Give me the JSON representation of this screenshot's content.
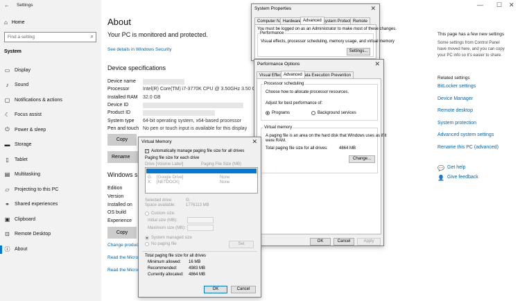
{
  "settings": {
    "window_title": "Settings",
    "home": "Home",
    "search_placeholder": "Find a setting",
    "section": "System",
    "nav": [
      {
        "label": "Display",
        "icon": "display-icon"
      },
      {
        "label": "Sound",
        "icon": "sound-icon"
      },
      {
        "label": "Notifications & actions",
        "icon": "notifications-icon"
      },
      {
        "label": "Focus assist",
        "icon": "focus-assist-icon"
      },
      {
        "label": "Power & sleep",
        "icon": "power-icon"
      },
      {
        "label": "Storage",
        "icon": "storage-icon"
      },
      {
        "label": "Tablet",
        "icon": "tablet-icon"
      },
      {
        "label": "Multitasking",
        "icon": "multitasking-icon"
      },
      {
        "label": "Projecting to this PC",
        "icon": "projecting-icon"
      },
      {
        "label": "Shared experiences",
        "icon": "shared-icon"
      },
      {
        "label": "Clipboard",
        "icon": "clipboard-icon"
      },
      {
        "label": "Remote Desktop",
        "icon": "remote-desktop-icon"
      },
      {
        "label": "About",
        "icon": "about-icon"
      }
    ]
  },
  "about": {
    "title": "About",
    "subtitle": "Your PC is monitored and protected.",
    "security_link": "See details in Windows Security",
    "device_specs_heading": "Device specifications",
    "specs": [
      {
        "key": "Device name",
        "value": ""
      },
      {
        "key": "Processor",
        "value": "Intel(R) Core(TM) i7-3770K CPU @ 3.50GHz   3.50 GHz"
      },
      {
        "key": "Installed RAM",
        "value": "32.0 GB"
      },
      {
        "key": "Device ID",
        "value": ""
      },
      {
        "key": "Product ID",
        "value": ""
      },
      {
        "key": "System type",
        "value": "64-bit operating system, x64-based processor"
      },
      {
        "key": "Pen and touch",
        "value": "No pen or touch input is available for this display"
      }
    ],
    "copy_button": "Copy",
    "rename_button": "Rename this P",
    "windows_spec_heading": "Windows sp",
    "win_specs": [
      "Edition",
      "Version",
      "Installed on",
      "OS build",
      "Experience"
    ],
    "copy_button_2": "Copy",
    "link_change_product": "Change product",
    "link_read_1": "Read the Micros",
    "link_read_2": "Read the Micros"
  },
  "right_pane": {
    "heading": "This page has a few new settings",
    "text_lines": [
      "Some settings from Control Panel",
      "have moved here, and you can copy",
      "your PC info so it's easier to share."
    ],
    "related_heading": "Related settings",
    "related": [
      "BitLocker settings",
      "Device Manager",
      "Remote desktop",
      "System protection",
      "Advanced system settings",
      "Rename this PC (advanced)"
    ],
    "help": "Get help",
    "feedback": "Give feedback"
  },
  "system_properties": {
    "title": "System Properties",
    "tabs": [
      "Computer Name",
      "Hardware",
      "Advanced",
      "System Protection",
      "Remote"
    ],
    "admin_note": "You must be logged on as an Administrator to make most of these changes.",
    "performance_label": "Performance",
    "performance_desc": "Visual effects, processor scheduling, memory usage, and virtual memory",
    "settings_button": "Settings..."
  },
  "performance_options": {
    "title": "Performance Options",
    "tabs": [
      "Visual Effects",
      "Advanced",
      "Data Execution Prevention"
    ],
    "proc_group": "Processor scheduling",
    "proc_desc": "Choose how to allocate processor resources.",
    "adjust_label": "Adjust for best performance of:",
    "radio_programs": "Programs",
    "radio_services": "Background services",
    "vm_group": "Virtual memory",
    "vm_desc_1": "A paging file is an area on the hard disk that Windows uses as if it",
    "vm_desc_2": "were RAM.",
    "total_label": "Total paging file size for all drives:",
    "total_value": "4864 MB",
    "change_button": "Change...",
    "ok": "OK",
    "cancel": "Cancel",
    "apply": "Apply"
  },
  "virtual_memory": {
    "title": "Virtual Memory",
    "auto_manage": "Automatically manage paging file size for all drives",
    "per_drive": "Paging file size for each drive",
    "col_drive": "Drive  [Volume Label]",
    "col_size": "Paging File Size (MB)",
    "drives": [
      {
        "drive": "",
        "label": "",
        "size": ""
      },
      {
        "drive": "G:",
        "label": "[Google Drive]",
        "size": "None"
      },
      {
        "drive": "X:",
        "label": "[NETDOCK]",
        "size": "None"
      }
    ],
    "selected_drive_label": "Selected drive:",
    "selected_drive_value": "G:",
    "space_available_label": "Space available:",
    "space_available_value": "1776113 MB",
    "custom_size": "Custom size:",
    "initial_size": "Initial size (MB):",
    "max_size": "Maximum size (MB):",
    "system_managed": "System managed size",
    "no_paging": "No paging file",
    "set_button": "Set",
    "total_heading": "Total paging file size for all drives",
    "min_label": "Minimum allowed:",
    "min_value": "16 MB",
    "rec_label": "Recommended:",
    "rec_value": "4983 MB",
    "cur_label": "Currently allocated:",
    "cur_value": "4864 MB",
    "ok": "OK",
    "cancel": "Cancel"
  },
  "colors": {
    "accent": "#0078d7",
    "link": "#0063b1",
    "sidebar": "#f2f2f2"
  }
}
